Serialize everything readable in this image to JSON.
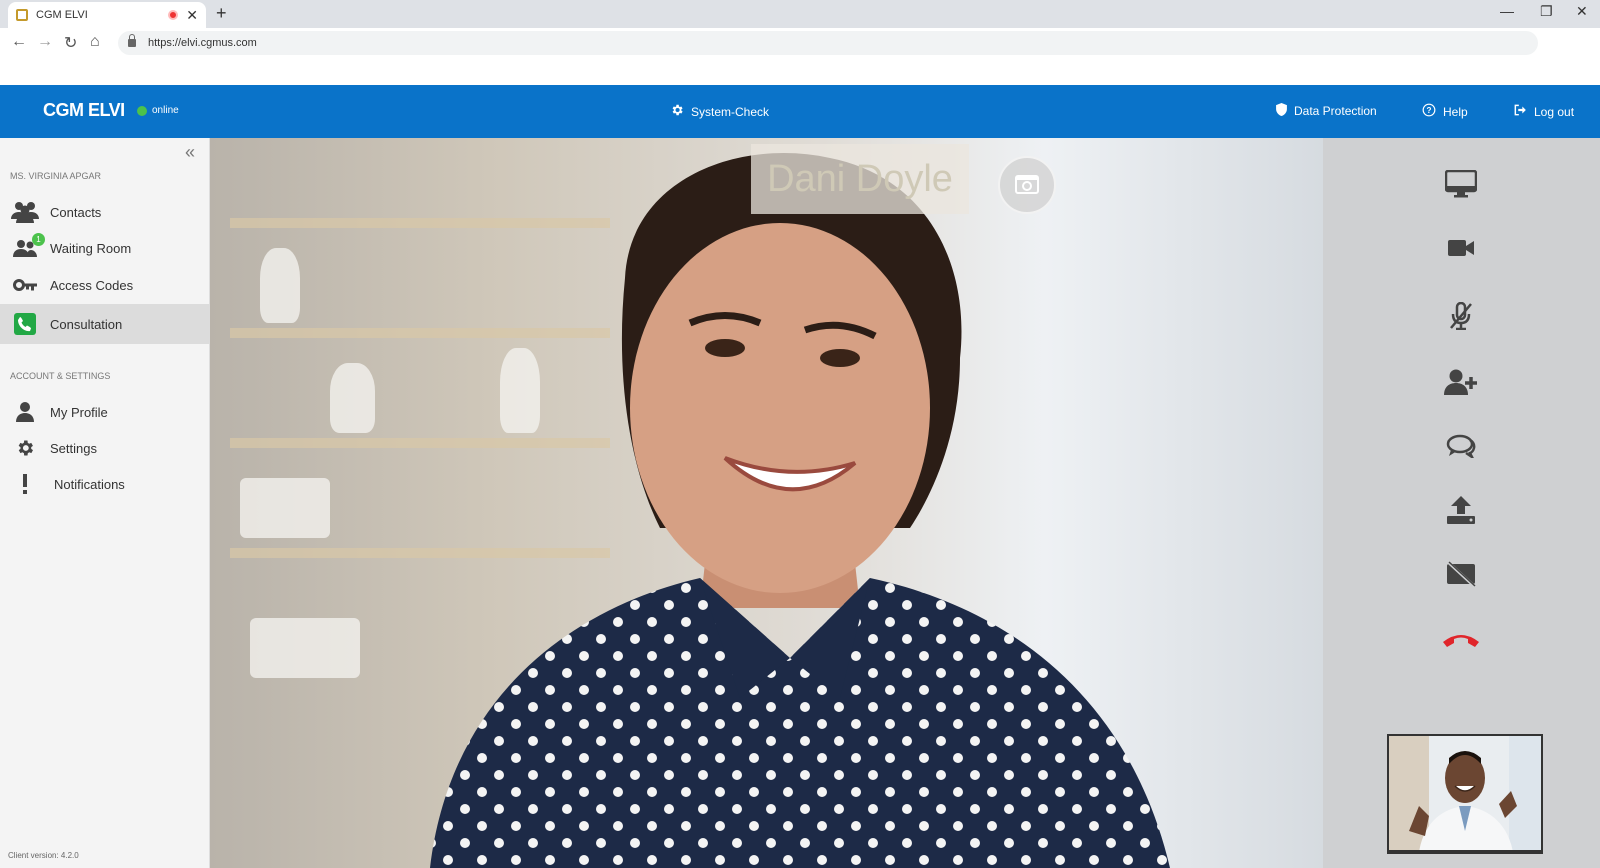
{
  "browser": {
    "tab_title": "CGM ELVI",
    "url": "https://elvi.cgmus.com"
  },
  "header": {
    "brand": "CGM ELVI",
    "status": "online",
    "system_check": "System-Check",
    "data_protection": "Data Protection",
    "help": "Help",
    "logout": "Log out"
  },
  "sidebar": {
    "user_section": "MS. VIRGINIA APGAR",
    "items": [
      {
        "label": "Contacts",
        "icon": "users-icon"
      },
      {
        "label": "Waiting Room",
        "icon": "waiting-room-icon",
        "badge": "1"
      },
      {
        "label": "Access Codes",
        "icon": "key-icon"
      },
      {
        "label": "Consultation",
        "icon": "phone-icon",
        "active": true
      }
    ],
    "account_section": "ACCOUNT & SETTINGS",
    "account_items": [
      {
        "label": "My Profile",
        "icon": "user-icon"
      },
      {
        "label": "Settings",
        "icon": "gear-icon"
      },
      {
        "label": "Notifications",
        "icon": "exclamation-icon"
      }
    ],
    "version": "Client version: 4.2.0"
  },
  "video": {
    "participant_name": "Dani Doyle"
  },
  "colors": {
    "brand": "#0a73c9",
    "online": "#4cc24c",
    "hangup": "#e0252b",
    "consult_icon": "#22a845"
  }
}
